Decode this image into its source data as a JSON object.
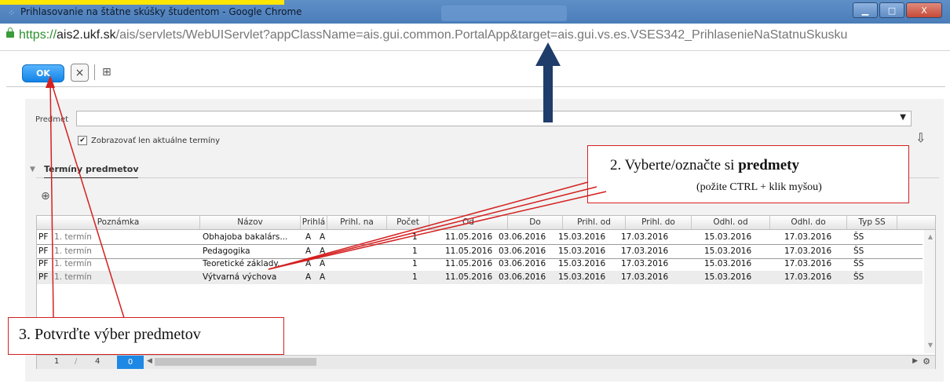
{
  "window": {
    "title": "Prihlasovanie na štátne skúšky študentom - Google Chrome",
    "minimize_label": "▁",
    "maximize_label": "□",
    "close_label": "X"
  },
  "address": {
    "scheme": "https://",
    "host": "ais2.ukf.sk",
    "path": "/ais/servlets/WebUIServlet?appClassName=ais.gui.common.PortalApp&target=ais.gui.vs.es.VSES342_PrihlasenieNaStatnuSkusku"
  },
  "toolbar": {
    "ok_label": "OK",
    "cancel_label": "×",
    "grid_icon": "⊞"
  },
  "form": {
    "predmet_label": "Predmet",
    "checkbox_mark": "✔",
    "checkbox_label": "Zobrazovať len aktuálne termíny",
    "section_title": "Termíny predmetov",
    "section_toggle": "▼"
  },
  "table": {
    "columns": [
      "Poznámka",
      "Názov",
      "Prihlá",
      "Prihl. na",
      "Počet",
      "Od",
      "Do",
      "Prihl. od",
      "Prihl. do",
      "Odhl. od",
      "Odhl. do",
      "Typ SS"
    ],
    "rows": [
      {
        "pf": "PF",
        "poznamka": "1. termín",
        "nazov": "Obhajoba bakalárs...",
        "prihla": "A",
        "prihl_na": "A",
        "pocet": "1",
        "od": "11.05.2016",
        "do": "03.06.2016",
        "prihl_od": "15.03.2016",
        "prihl_do": "17.03.2016",
        "odhl_od": "15.03.2016",
        "odhl_do": "17.03.2016",
        "typ": "ŠS"
      },
      {
        "pf": "PF",
        "poznamka": "1. termín",
        "nazov": "Pedagogika",
        "prihla": "A",
        "prihl_na": "A",
        "pocet": "1",
        "od": "11.05.2016",
        "do": "03.06.2016",
        "prihl_od": "15.03.2016",
        "prihl_do": "17.03.2016",
        "odhl_od": "15.03.2016",
        "odhl_do": "17.03.2016",
        "typ": "ŠS"
      },
      {
        "pf": "PF",
        "poznamka": "1. termín",
        "nazov": "Teoretické základy...",
        "prihla": "A",
        "prihl_na": "A",
        "pocet": "1",
        "od": "11.05.2016",
        "do": "03.06.2016",
        "prihl_od": "15.03.2016",
        "prihl_do": "17.03.2016",
        "odhl_od": "15.03.2016",
        "odhl_do": "17.03.2016",
        "typ": "ŠS"
      },
      {
        "pf": "PF",
        "poznamka": "1. termín",
        "nazov": "Výtvarná výchova",
        "prihla": "A",
        "prihl_na": "A",
        "pocet": "1",
        "od": "11.05.2016",
        "do": "03.06.2016",
        "prihl_od": "15.03.2016",
        "prihl_do": "17.03.2016",
        "odhl_od": "15.03.2016",
        "odhl_do": "17.03.2016",
        "typ": "ŠS"
      }
    ]
  },
  "pager": {
    "current": "1",
    "separator": "/",
    "total": "4",
    "selected_count": "0"
  },
  "annotations": {
    "step2_prefix": "2. Vyberte/označte  si ",
    "step2_bold": "predmety",
    "step2_hint": "(požite CTRL + klik myšou)",
    "step3": "3. Potvrďte výber predmetov"
  },
  "colors": {
    "annotation_red": "#d42020",
    "arrow_navy": "#1f3d6b",
    "ok_blue": "#1283e6"
  }
}
